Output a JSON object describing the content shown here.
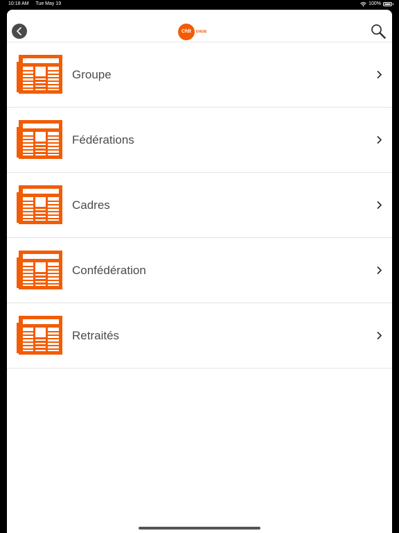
{
  "status_bar": {
    "time": "10:18 AM",
    "date": "Tue May 19",
    "battery": "100%",
    "icons": [
      "wifi-icon",
      "battery-icon"
    ]
  },
  "header": {
    "back_icon": "chevron-left-icon",
    "logo_text": "Cfdt",
    "logo_subtext": "ENGIE",
    "search_icon": "search-icon"
  },
  "colors": {
    "accent": "#f25c05",
    "text": "#4b4b4b",
    "divider": "#e3e3e3"
  },
  "list": {
    "icon": "newspaper-icon",
    "items": [
      {
        "label": "Groupe"
      },
      {
        "label": "Fédérations"
      },
      {
        "label": "Cadres"
      },
      {
        "label": "Confédération"
      },
      {
        "label": "Retraités"
      }
    ]
  }
}
